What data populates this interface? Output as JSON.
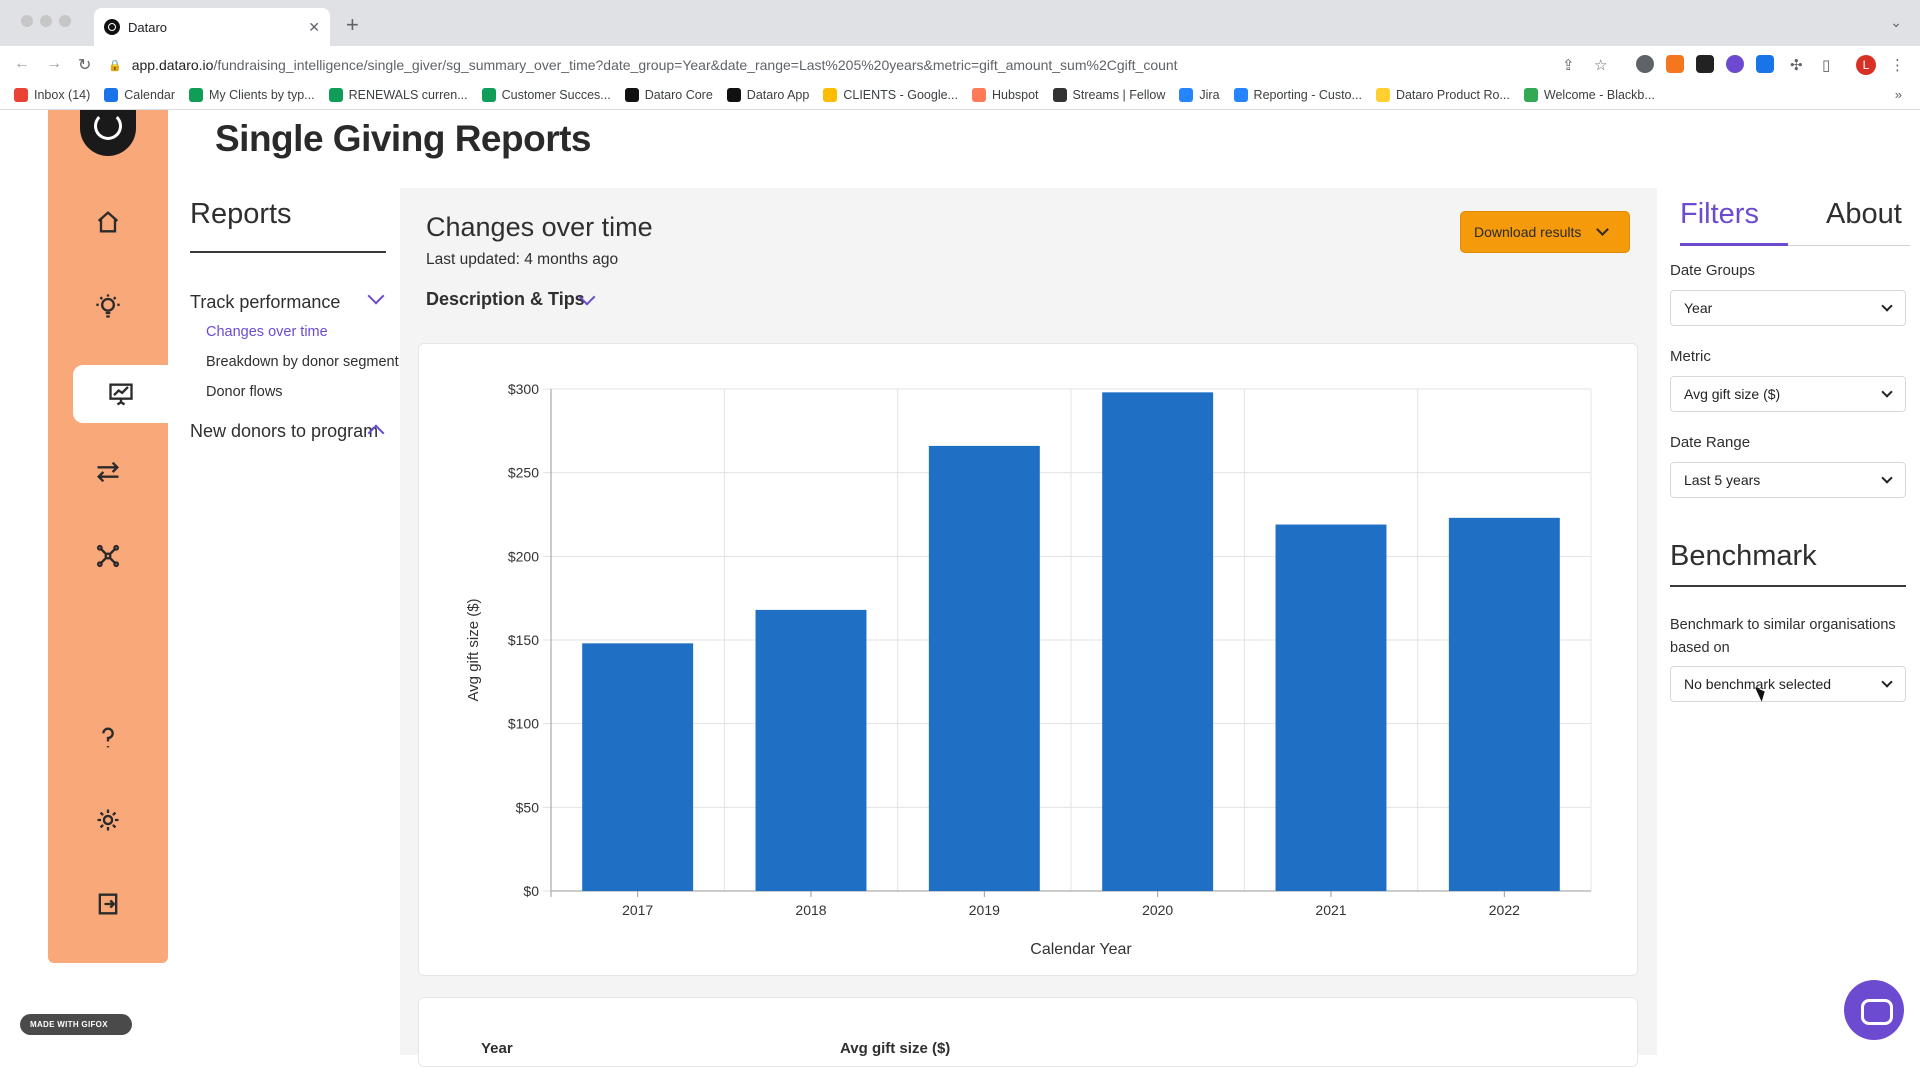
{
  "browser": {
    "tab_title": "Dataro",
    "url_host": "app.dataro.io",
    "url_path": "/fundraising_intelligence/single_giver/sg_summary_over_time?date_group=Year&date_range=Last%205%20years&metric=gift_amount_sum%2Cgift_count",
    "profile_initial": "L",
    "bookmarks": [
      {
        "label": "Inbox (14)",
        "icon": "gmail-icon",
        "color": "#ea4335"
      },
      {
        "label": "Calendar",
        "icon": "calendar-icon",
        "color": "#1a73e8"
      },
      {
        "label": "My Clients by typ...",
        "icon": "sheets-icon",
        "color": "#0f9d58"
      },
      {
        "label": "RENEWALS curren...",
        "icon": "sheets-icon",
        "color": "#0f9d58"
      },
      {
        "label": "Customer Succes...",
        "icon": "sheets-icon",
        "color": "#0f9d58"
      },
      {
        "label": "Dataro Core",
        "icon": "dataro-icon",
        "color": "#111111"
      },
      {
        "label": "Dataro App",
        "icon": "dataro-icon",
        "color": "#111111"
      },
      {
        "label": "CLIENTS - Google...",
        "icon": "drive-icon",
        "color": "#fbbc04"
      },
      {
        "label": "Hubspot",
        "icon": "hubspot-icon",
        "color": "#ff7a59"
      },
      {
        "label": "Streams | Fellow",
        "icon": "fellow-icon",
        "color": "#333333"
      },
      {
        "label": "Jira",
        "icon": "jira-icon",
        "color": "#2684ff"
      },
      {
        "label": "Reporting - Custo...",
        "icon": "confluence-icon",
        "color": "#2684ff"
      },
      {
        "label": "Dataro Product Ro...",
        "icon": "miro-icon",
        "color": "#ffd02f"
      },
      {
        "label": "Welcome - Blackb...",
        "icon": "blackbaud-icon",
        "color": "#34a853"
      }
    ]
  },
  "app": {
    "page_title": "Single Giving Reports",
    "reports_heading": "Reports",
    "nav_groups": [
      {
        "label": "Track performance",
        "items": [
          "Changes over time",
          "Breakdown by donor segment",
          "Donor flows"
        ]
      },
      {
        "label": "New donors to program",
        "items": []
      }
    ]
  },
  "report": {
    "title": "Changes over time",
    "last_updated": "Last updated: 4 months ago",
    "description_toggle": "Description & Tips",
    "download_label": "Download results"
  },
  "filters": {
    "tab_filters": "Filters",
    "tab_about": "About",
    "date_groups_label": "Date Groups",
    "date_groups_value": "Year",
    "metric_label": "Metric",
    "metric_value": "Avg gift size ($)",
    "date_range_label": "Date Range",
    "date_range_value": "Last 5 years",
    "benchmark_heading": "Benchmark",
    "benchmark_desc": "Benchmark to similar organisations based on",
    "benchmark_value": "No benchmark selected"
  },
  "table": {
    "col_year": "Year",
    "col_metric": "Avg gift size ($)"
  },
  "gifox_badge": "MADE WITH GIFOX",
  "colors": {
    "sidebar": "#f9a87a",
    "accent": "#6c4bd1",
    "download": "#f59a0b",
    "bar": "#1f6fc5"
  },
  "chart_data": {
    "type": "bar",
    "categories": [
      "2017",
      "2018",
      "2019",
      "2020",
      "2021",
      "2022"
    ],
    "values": [
      148,
      168,
      266,
      298,
      219,
      223
    ],
    "xlabel": "Calendar Year",
    "ylabel": "Avg gift size ($)",
    "ylim": [
      0,
      300
    ],
    "yticks": [
      0,
      50,
      100,
      150,
      200,
      250,
      300
    ],
    "ytick_labels": [
      "$0",
      "$50",
      "$100",
      "$150",
      "$200",
      "$250",
      "$300"
    ],
    "grid": true
  }
}
